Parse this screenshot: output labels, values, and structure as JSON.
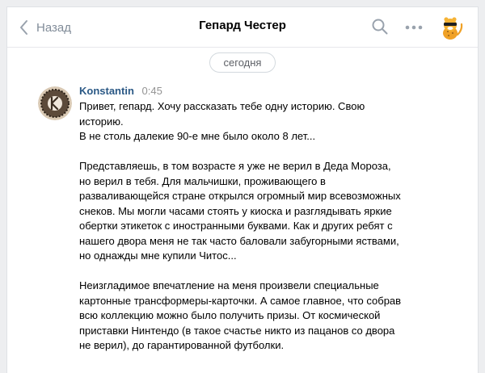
{
  "header": {
    "back_label": "Назад",
    "title": "Гепард Честер"
  },
  "date_separator": "сегодня",
  "message": {
    "author": "Konstantin",
    "time": "0:45",
    "paragraphs": [
      "Привет, гепард. Хочу рассказать тебе одну историю. Свою историю.",
      "В не столь далекие 90-е мне было около 8 лет...",
      "",
      "Представляешь, в том возрасте я уже не верил в Деда Мороза, но верил в тебя. Для мальчишки, проживающего в разваливающейся стране открылся огромный мир всевозможных снеков. Мы могли часами стоять у киоска и разглядывать яркие обертки этикеток с иностранными буквами. Как и других ребят с нашего двора меня не так часто баловали забугорными яствами, но однажды мне купили Читос...",
      "",
      "Неизгладимое впечатление на меня произвели специальные картонные трансформеры-карточки. А самое главное, что собрав всю коллекцию можно было получить призы. От космической приставки Нинтендо (в такое счастье никто из пацанов со двора не верил), до гарантированной футболки."
    ]
  },
  "icons": {
    "back": "chevron-left-icon",
    "search": "search-icon",
    "more": "more-dots-icon"
  },
  "colors": {
    "link": "#2a5885",
    "muted": "#818c99",
    "background": "#edeef0"
  }
}
